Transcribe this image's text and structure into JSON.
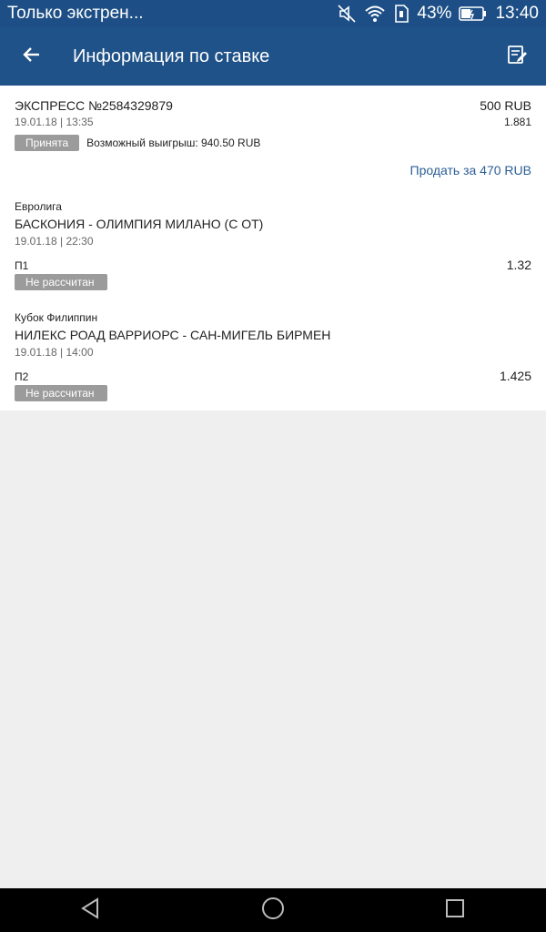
{
  "status_bar": {
    "notification_text": "Только экстрен...",
    "battery": "43%",
    "time": "13:40",
    "icons": [
      "mute-icon",
      "wifi-icon",
      "sim-icon",
      "battery-icon"
    ]
  },
  "app_bar": {
    "title": "Информация по ставке",
    "back_icon": "arrow-back-icon",
    "edit_icon": "edit-note-icon"
  },
  "bet": {
    "name": "ЭКСПРЕСС №2584329879",
    "amount": "500 RUB",
    "datetime": "19.01.18 | 13:35",
    "coefficient": "1.881",
    "status": "Принята",
    "possible_win": "Возможный выигрыш: 940.50 RUB",
    "sell_label": "Продать за 470 RUB"
  },
  "events": [
    {
      "league": "Евролига",
      "match": "БАСКОНИЯ - ОЛИМПИЯ МИЛАНО (С ОТ)",
      "datetime": "19.01.18 | 22:30",
      "outcome": "П1",
      "coef": "1.32",
      "status": "Не рассчитан"
    },
    {
      "league": "Кубок Филиппин",
      "match": "НИЛЕКС РОАД ВАРРИОРС - САН-МИГЕЛЬ БИРМЕН",
      "datetime": "19.01.18 | 14:00",
      "outcome": "П2",
      "coef": "1.425",
      "status": "Не рассчитан"
    }
  ],
  "colors": {
    "header": "#1f5288",
    "status_bar": "#1d4f86",
    "badge": "#9b9b9b",
    "link": "#2c5e96"
  }
}
